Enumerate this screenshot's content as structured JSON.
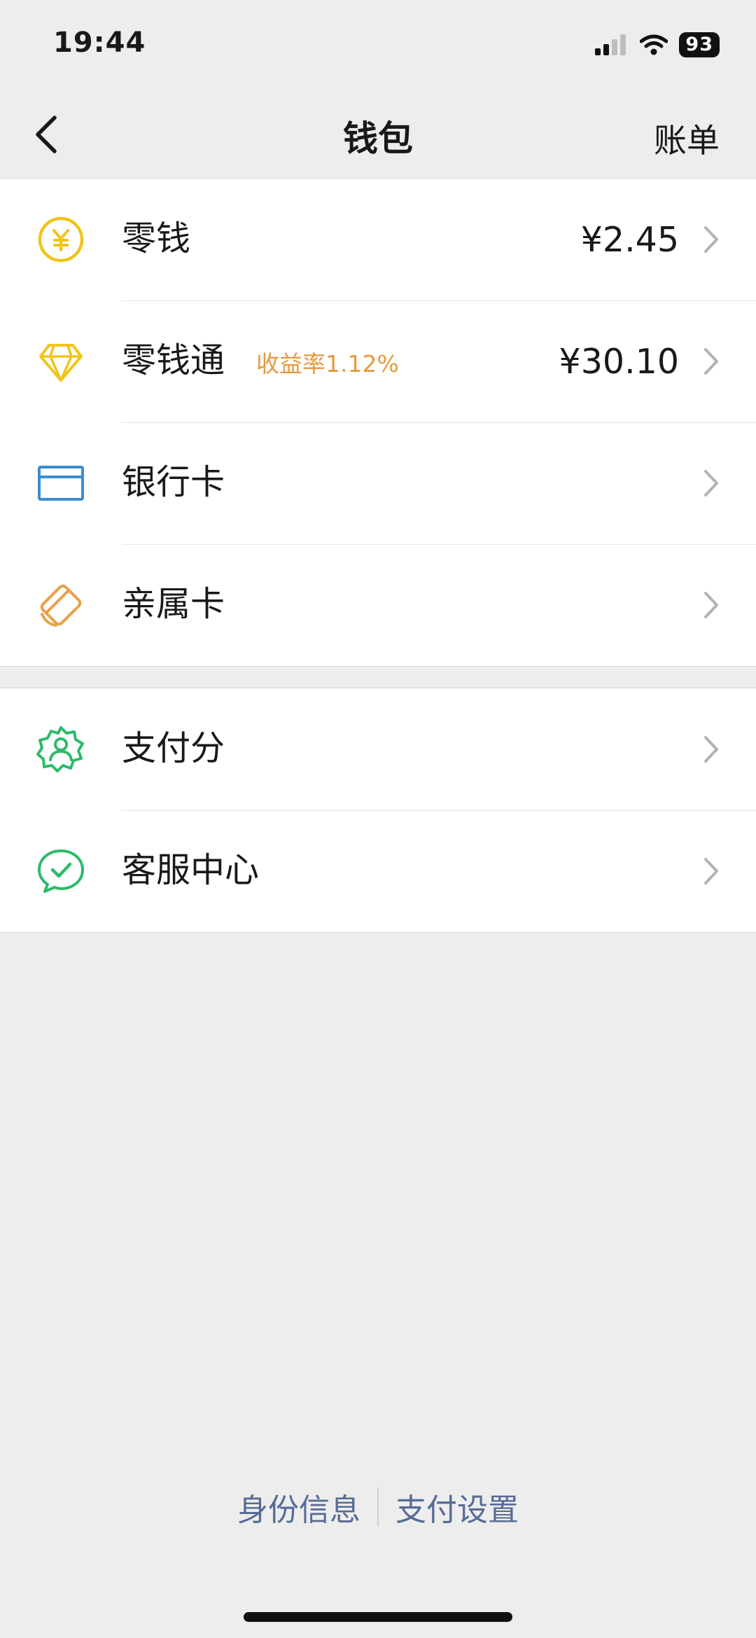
{
  "status_bar": {
    "time": "19:44",
    "battery": "93",
    "icons": [
      "signal-icon",
      "wifi-icon",
      "battery-icon"
    ]
  },
  "nav": {
    "back_icon": "chevron-left-icon",
    "title": "钱包",
    "action": "账单"
  },
  "wallet_items": [
    {
      "label": "零钱",
      "value": "¥2.45",
      "icon": "yuan-coin-icon"
    },
    {
      "label": "零钱通",
      "tag": "收益率1.12%",
      "value": "¥30.10",
      "icon": "diamond-icon"
    },
    {
      "label": "银行卡",
      "icon": "bank-card-icon"
    },
    {
      "label": "亲属卡",
      "icon": "family-card-icon"
    }
  ],
  "service_items": [
    {
      "label": "支付分",
      "icon": "payment-score-icon"
    },
    {
      "label": "客服中心",
      "icon": "customer-service-icon"
    }
  ],
  "footer": {
    "identity": "身份信息",
    "settings": "支付设置"
  },
  "colors": {
    "background": "#ededed",
    "panel": "#ffffff",
    "coin": "#f0c419",
    "tag": "#e59a3d",
    "bank_card": "#3a8ccf",
    "family_card": "#e8a04a",
    "green": "#2dba6a",
    "link": "#576b95"
  }
}
